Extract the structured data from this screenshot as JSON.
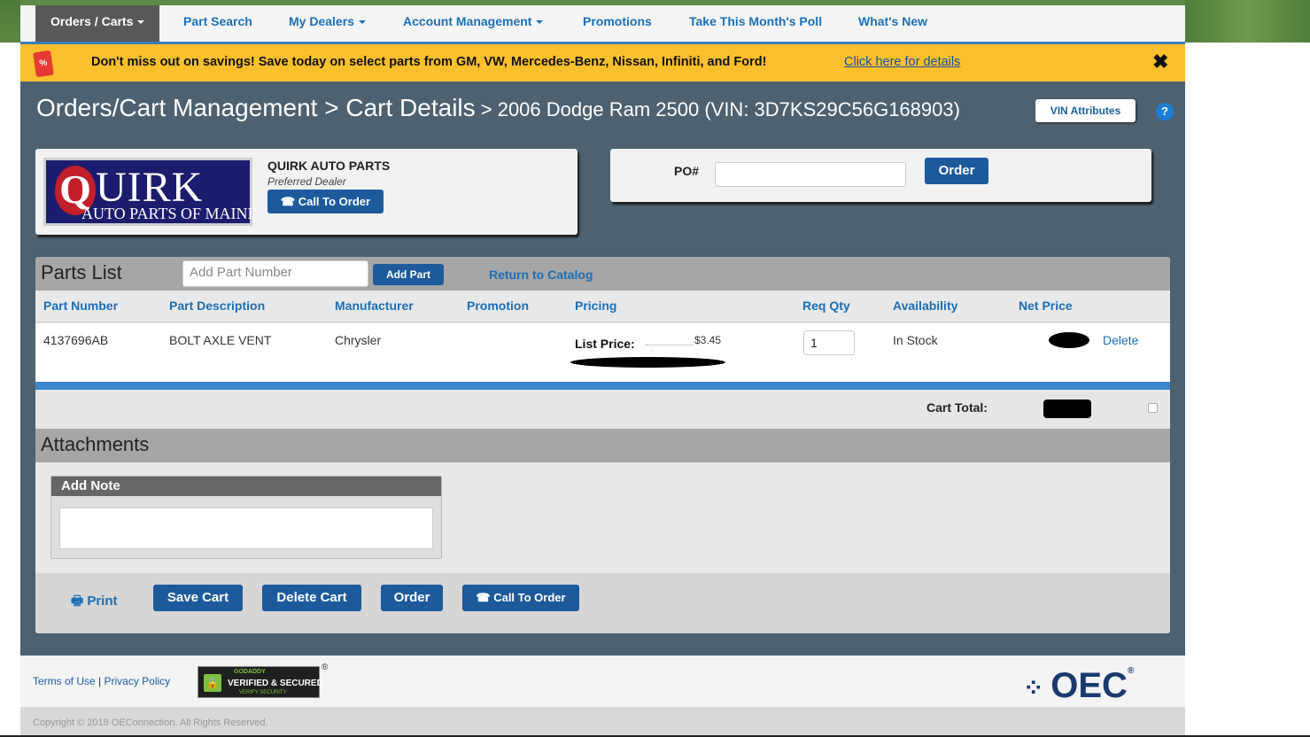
{
  "nav": {
    "items": [
      {
        "label": "Orders / Carts",
        "caret": true
      },
      {
        "label": "Part Search"
      },
      {
        "label": "My Dealers",
        "caret": true
      },
      {
        "label": "Account Management",
        "caret": true
      },
      {
        "label": "Promotions"
      },
      {
        "label": "Take This Month's Poll"
      },
      {
        "label": "What's New"
      }
    ]
  },
  "banner": {
    "icon": "%",
    "text": "Don't miss out on savings! Save today on select parts from GM, VW, Mercedes-Benz, Nissan, Infiniti, and Ford!",
    "link": "Click here for details",
    "close": "✖"
  },
  "header": {
    "title": "Orders/Cart Management > Cart Details",
    "subtitle": " > 2006 Dodge Ram 2500 (VIN: 3D7KS29C56G168903)",
    "vin_button": "VIN Attributes",
    "help": "?"
  },
  "dealer": {
    "logo_q": "Q",
    "logo_uirk": "UIRK",
    "logo_sub": "AUTO PARTS OF MAINE",
    "name": "QUIRK AUTO PARTS",
    "status": "Preferred Dealer",
    "call_button": "☎ Call To Order"
  },
  "po": {
    "label": "PO#",
    "value": "",
    "order_button": "Order"
  },
  "parts": {
    "title": "Parts List",
    "input_placeholder": "Add Part Number",
    "add_button": "Add Part",
    "return_link": "Return to Catalog",
    "columns": [
      "Part Number",
      "Part Description",
      "Manufacturer",
      "Promotion",
      "Pricing",
      "Req Qty",
      "Availability",
      "Net Price"
    ],
    "rows": [
      {
        "part_number": "4137696AB",
        "description": "BOLT AXLE VENT",
        "manufacturer": "Chrysler",
        "promotion": "",
        "list_price_label": "List Price:",
        "list_price": "$3.45",
        "qty": "1",
        "availability": "In Stock",
        "delete": "Delete"
      }
    ],
    "cart_total_label": "Cart Total:"
  },
  "attachments": {
    "title": "Attachments",
    "note_title": "Add Note",
    "note_value": ""
  },
  "actions": {
    "print": "Print",
    "save": "Save Cart",
    "delete": "Delete Cart",
    "order": "Order",
    "call": "☎ Call To Order"
  },
  "footer": {
    "terms": "Terms of Use",
    "separator": "|",
    "privacy": "Privacy Policy",
    "badge_top": "GODADDY",
    "badge_main": "VERIFIED & SECURED",
    "badge_sub": "VERIFY SECURITY",
    "brand": "OEC",
    "copyright": "Copyright © 2018 OEConnection. All Rights Reserved."
  },
  "colors": {
    "nav_link": "#1c6fb5",
    "banner": "#fbc02d",
    "app_bg": "#4d6170",
    "button": "#1c5a9c"
  }
}
